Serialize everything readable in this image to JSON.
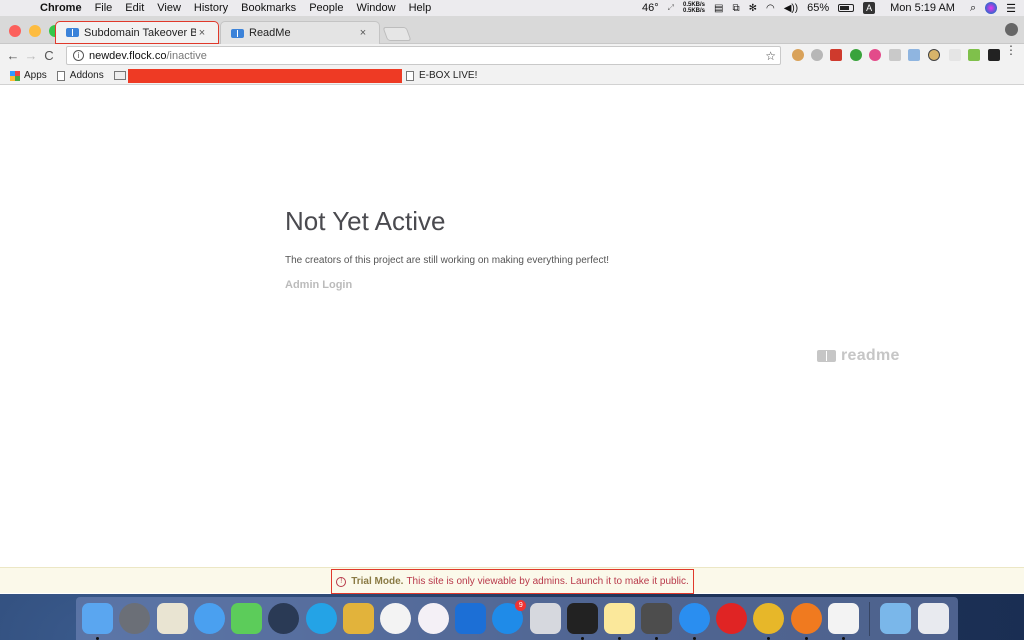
{
  "menubar": {
    "apple_icon": "apple-icon",
    "app_name": "Chrome",
    "items": [
      "File",
      "Edit",
      "View",
      "History",
      "Bookmarks",
      "People",
      "Window",
      "Help"
    ],
    "status": {
      "temperature": "46°",
      "net_up": "0.5KB/s",
      "net_down": "0.5KB/s",
      "battery": "65%",
      "input_source": "A",
      "clock": "Mon 5:19 AM"
    }
  },
  "browser": {
    "tabs": [
      {
        "label": "Subdomain Takeover By Prial",
        "active": true,
        "close": "×"
      },
      {
        "label": "ReadMe",
        "active": false,
        "close": "×"
      }
    ],
    "nav": {
      "back": "←",
      "forward": "→",
      "reload": "C"
    },
    "address": {
      "host": "newdev.flock.co",
      "path": "/inactive",
      "info_icon": "i",
      "star": "☆"
    },
    "bookmarks": [
      {
        "label": "Apps",
        "icon": "apps-grid-icon"
      },
      {
        "label": "Addons",
        "icon": "page-icon"
      },
      {
        "label": "",
        "icon": "folder-icon"
      },
      {
        "label": "E-BOX LIVE!",
        "icon": "page-icon"
      }
    ],
    "extensions": [
      "cookie",
      "grey-ext",
      "lastpass",
      "green-ext",
      "pink-ext",
      "grey-box",
      "fit",
      "no-sign",
      "white-box",
      "download",
      "trash-ext"
    ],
    "menu": "⋮"
  },
  "page": {
    "title": "Not Yet Active",
    "description": "The creators of this project are still working on making everything perfect!",
    "admin_login": "Admin Login",
    "logo_text": "readme"
  },
  "trial_banner": {
    "icon": "!",
    "bold": "Trial Mode.",
    "message": "This site is only viewable by admins. Launch it to make it public."
  },
  "dock": {
    "apps": [
      {
        "name": "Finder",
        "color": "#5aa6f0",
        "running": true
      },
      {
        "name": "Launchpad",
        "color": "#6b6f77",
        "round": true
      },
      {
        "name": "Maps",
        "color": "#e9e4d2"
      },
      {
        "name": "Messages",
        "color": "#4aa0f0",
        "round": true
      },
      {
        "name": "FaceTime",
        "color": "#5ccc5a"
      },
      {
        "name": "QuickTime",
        "color": "#2a3a55",
        "round": true
      },
      {
        "name": "Skype",
        "color": "#24a3e6",
        "round": true
      },
      {
        "name": "Slack",
        "color": "#e2b33b"
      },
      {
        "name": "Photos",
        "color": "#f3f3f3",
        "round": true
      },
      {
        "name": "iTunes",
        "color": "#f4f0f6",
        "round": true
      },
      {
        "name": "TeamViewer",
        "color": "#1c6fd6"
      },
      {
        "name": "App Store",
        "color": "#1f8be8",
        "round": true,
        "badge": "9"
      },
      {
        "name": "System Preferences",
        "color": "#d6d8de"
      },
      {
        "name": "Terminal",
        "color": "#222",
        "running": true
      },
      {
        "name": "Notes",
        "color": "#fbe89b",
        "running": true
      },
      {
        "name": "Sublime Text",
        "color": "#4d4d4d",
        "running": true
      },
      {
        "name": "Safari",
        "color": "#2a8ef0",
        "round": true,
        "running": true
      },
      {
        "name": "Opera",
        "color": "#e02424",
        "round": true
      },
      {
        "name": "Chrome",
        "color": "#e7b729",
        "round": true,
        "running": true
      },
      {
        "name": "Firefox",
        "color": "#f07a1f",
        "round": true,
        "running": true
      },
      {
        "name": "Java",
        "color": "#f3f3f3",
        "running": true
      }
    ],
    "others": [
      {
        "name": "Applications",
        "color": "#7ab7ea"
      },
      {
        "name": "Trash",
        "color": "#e8eaef"
      }
    ]
  }
}
